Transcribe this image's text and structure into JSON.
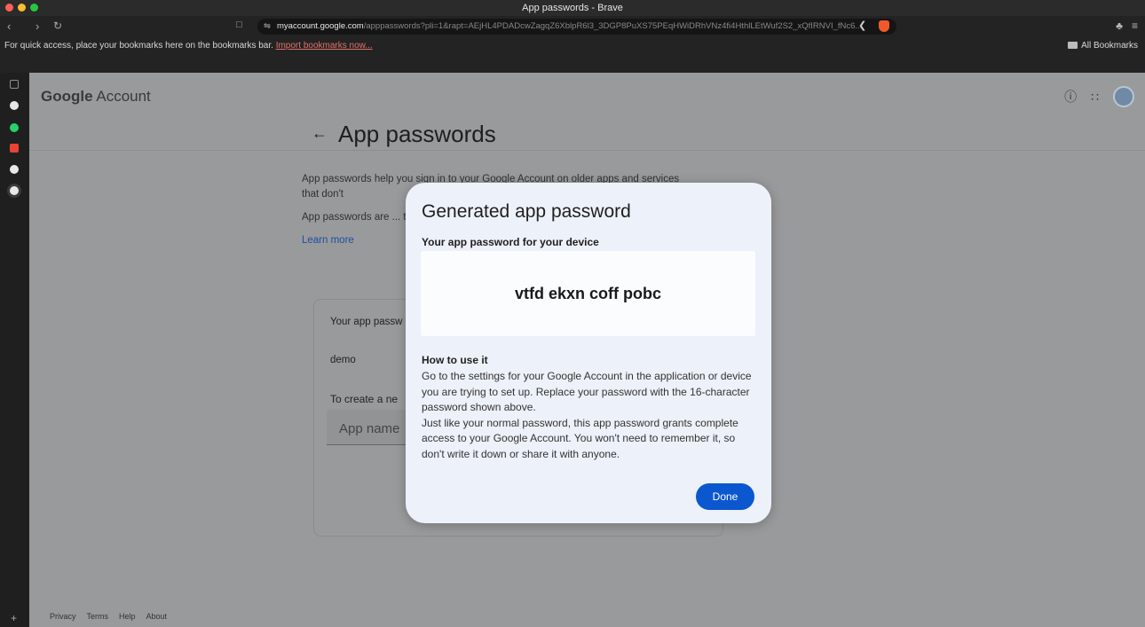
{
  "browser": {
    "window_title": "App passwords - Brave",
    "url_host": "myaccount.google.com",
    "url_path": "/apppasswords?pli=1&rapt=AEjHL4PDADcwZagqZ6XblpR6l3_3DGP8PuXS75PEqHWiDRhVNz4fi4HthlLEtWuf2S2_xQfIRNVI_fNc6...",
    "bookmarks_prompt": "For quick access, place your bookmarks here on the bookmarks bar.",
    "import_link": "Import bookmarks now...",
    "all_bookmarks": "All Bookmarks",
    "icons": [
      "back-icon",
      "forward-icon",
      "reload-icon",
      "bookmark-icon",
      "site-settings-icon",
      "share-icon",
      "brave-shield-icon",
      "extensions-icon",
      "menu-icon",
      "folder-icon"
    ],
    "traffic_colors": [
      "#ff5f57",
      "#febc2e",
      "#28c840"
    ]
  },
  "side_panel": {
    "icons": [
      {
        "name": "sidebar-toggle-icon",
        "color": "#8f8f8f"
      },
      {
        "name": "github-icon",
        "color": "#e6e6e6"
      },
      {
        "name": "whatsapp-icon",
        "color": "#25d366"
      },
      {
        "name": "gmail-icon",
        "color": "#ea4335"
      },
      {
        "name": "chrome-icon",
        "color": "#e8e8e8"
      },
      {
        "name": "chrome-icon-2",
        "color": "#e8e8e8"
      }
    ],
    "add_label": "+"
  },
  "account_page": {
    "logo_google": "Google",
    "logo_account": "Account",
    "title": "App passwords",
    "intro_1": "App passwords help you sign in to your Google Account on older apps and services that don't",
    "intro_2": "App passwords are ... that use modern se... you should check t...",
    "learn_more": "Learn more",
    "card_label": "Your app passw",
    "existing_app": "demo",
    "create_label": "To create a ne",
    "app_name_placeholder": "App name",
    "footer": [
      "Privacy",
      "Terms",
      "Help",
      "About"
    ]
  },
  "dialog": {
    "title": "Generated app password",
    "subtitle": "Your app password for your device",
    "password": "vtfd ekxn coff pobc",
    "how_title": "How to use it",
    "how_text": "Go to the settings for your Google Account in the application or device you are trying to set up. Replace your password with the 16-character password shown above.",
    "how_text_2": "Just like your normal password, this app password grants complete access to your Google Account. You won't need to remember it, so don't write it down or share it with anyone.",
    "done_label": "Done",
    "accent_color": "#0b57d0"
  }
}
